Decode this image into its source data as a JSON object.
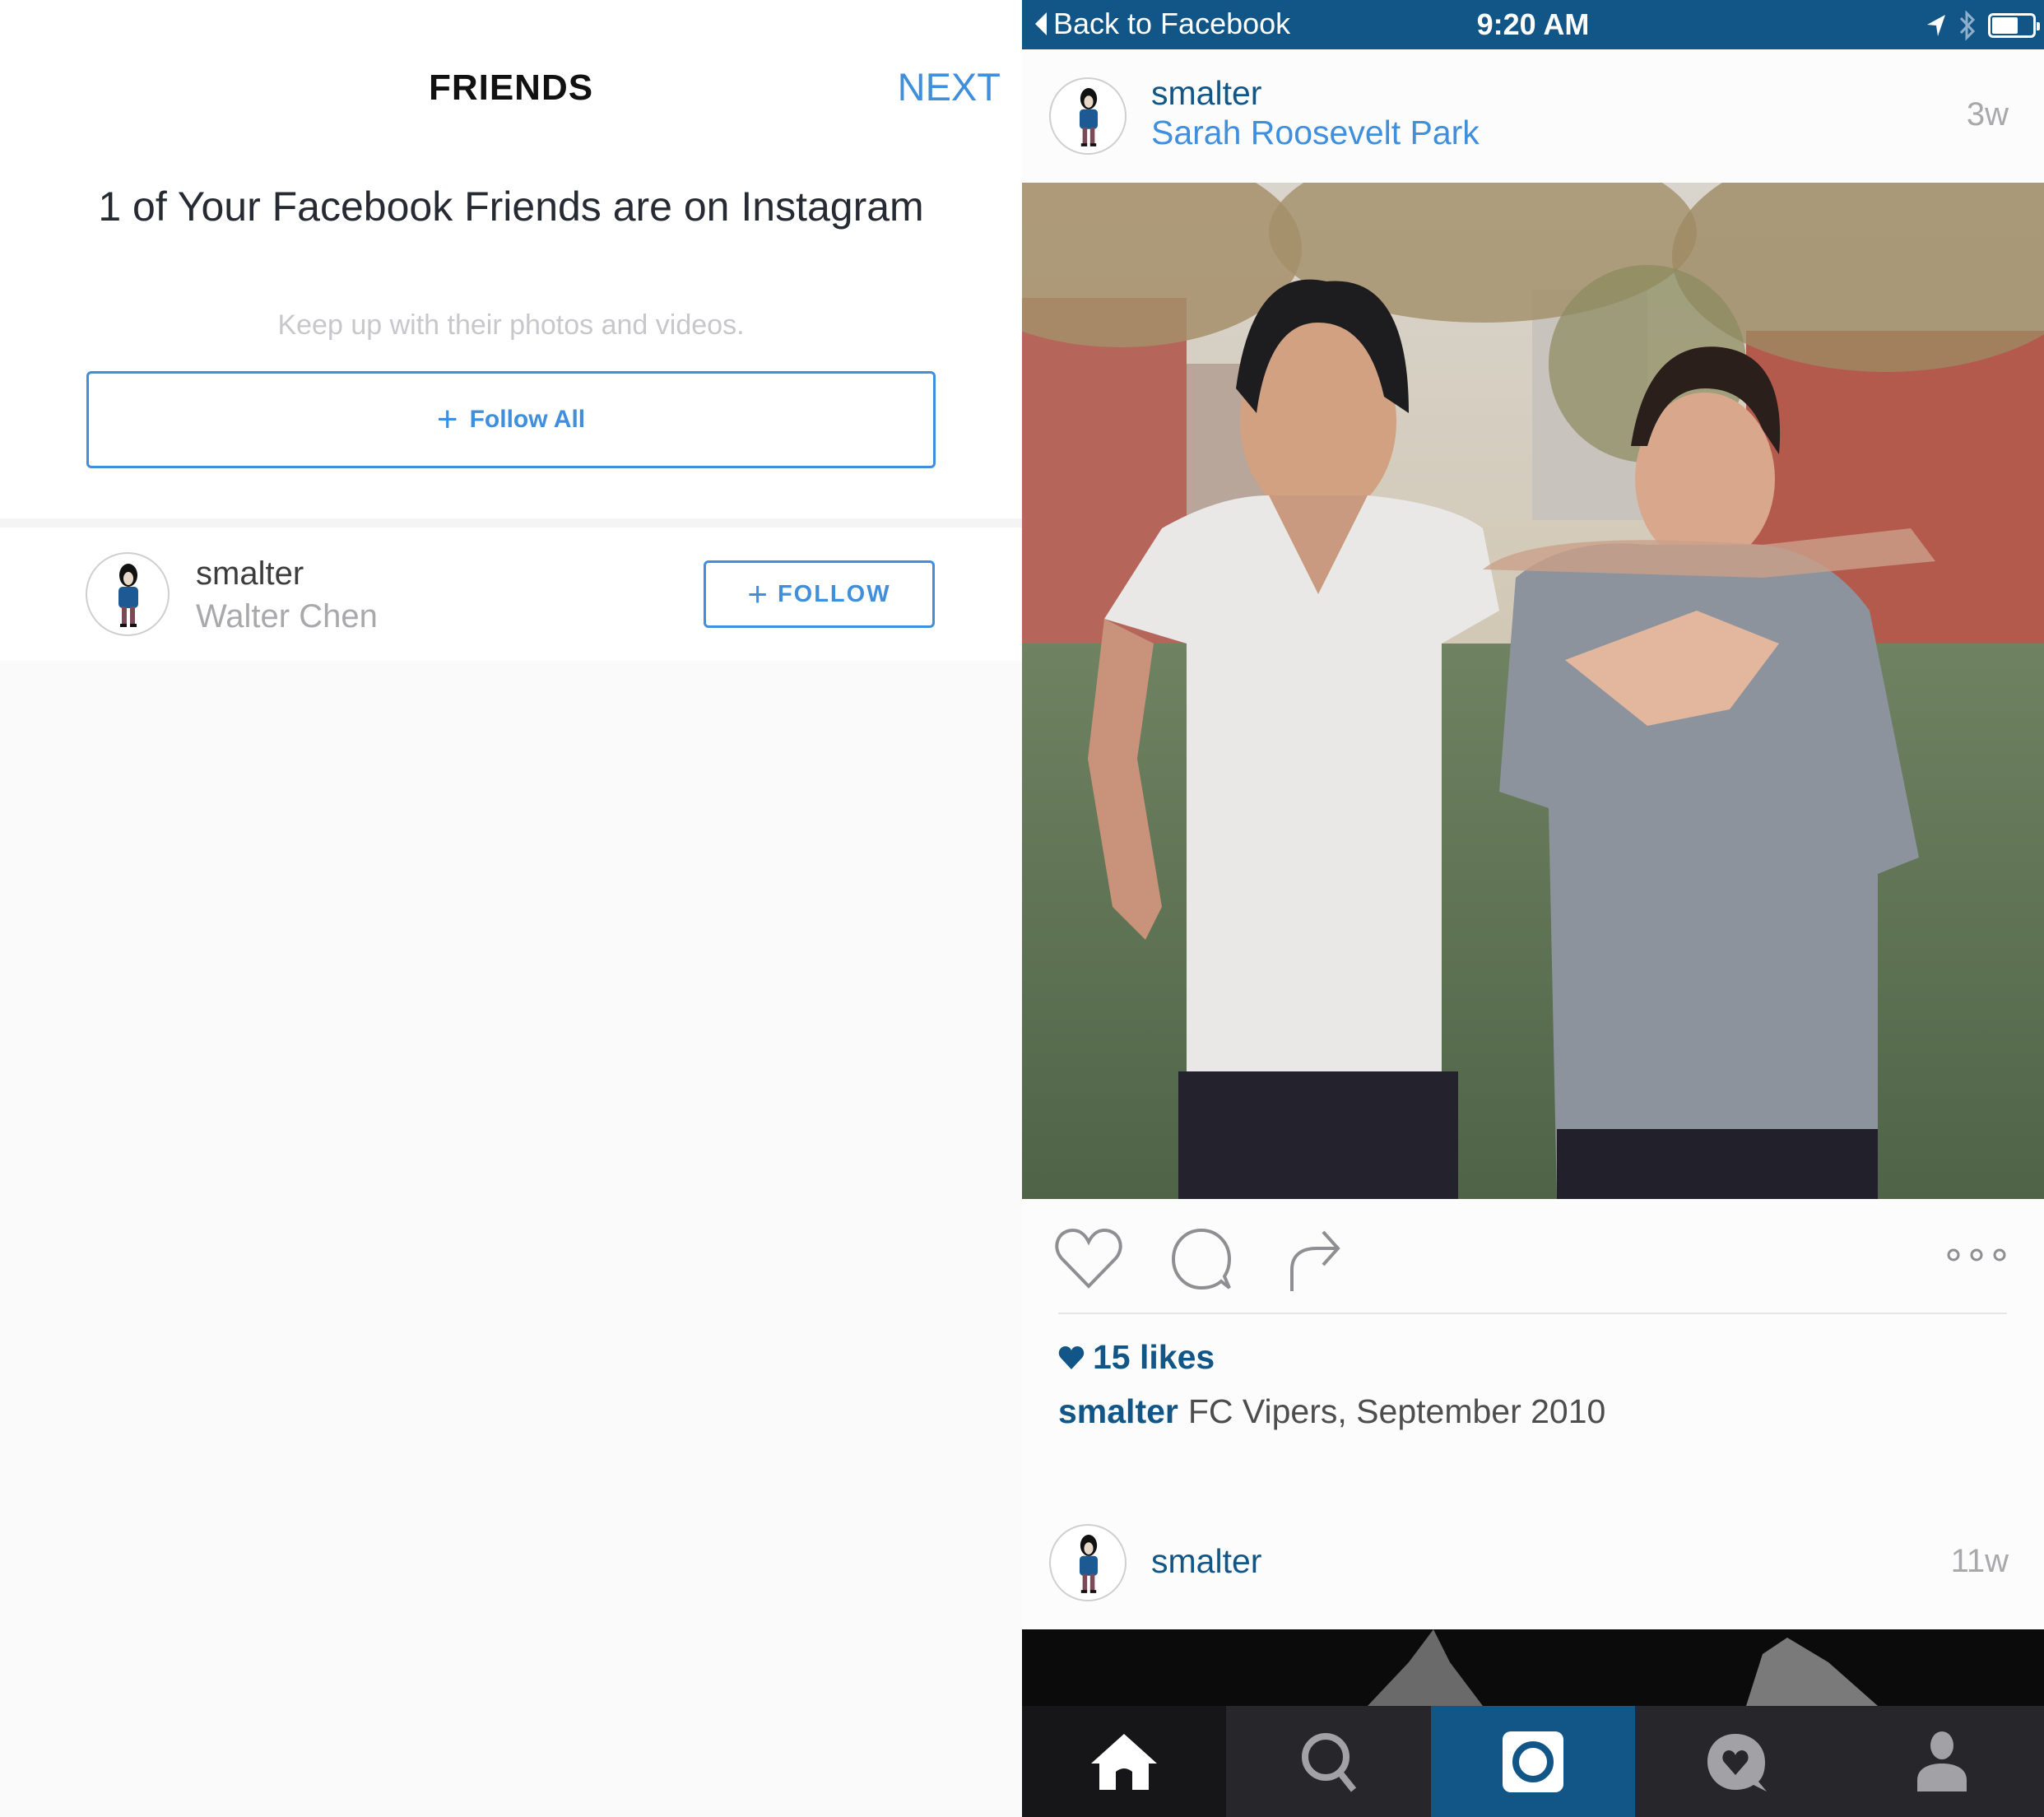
{
  "left_panel": {
    "title": "FRIENDS",
    "next_label": "NEXT",
    "heading": "1 of Your Facebook Friends are on Instagram",
    "subtitle": "Keep up with their photos and videos.",
    "follow_all_label": "Follow All",
    "friends": [
      {
        "username": "smalter",
        "full_name": "Walter Chen",
        "follow_label": "FOLLOW"
      }
    ]
  },
  "right_panel": {
    "status_bar": {
      "back_label": "Back to Facebook",
      "time": "9:20 AM",
      "icons": [
        "location-arrow-icon",
        "bluetooth-icon",
        "battery-icon"
      ]
    },
    "posts": [
      {
        "username": "smalter",
        "location": "Sarah Roosevelt Park",
        "age": "3w",
        "photo_description": "Two young men in wet t-shirts standing on a soccer field in the rain, trees and brick buildings behind",
        "likes": "15 likes",
        "caption_user": "smalter",
        "caption_text": "FC Vipers, September 2010"
      },
      {
        "username": "smalter",
        "age": "11w",
        "photo_description": "Black and white photo of building spires"
      }
    ],
    "tab_bar": [
      {
        "name": "home",
        "icon": "home-icon",
        "active": true
      },
      {
        "name": "search",
        "icon": "search-icon",
        "active": false
      },
      {
        "name": "camera",
        "icon": "camera-icon",
        "active": false
      },
      {
        "name": "activity",
        "icon": "activity-heart-icon",
        "active": false
      },
      {
        "name": "profile",
        "icon": "profile-icon",
        "active": false
      }
    ]
  },
  "colors": {
    "brand_blue": "#125688",
    "link_blue": "#3f8fdc",
    "tabbar_bg": "#26262b"
  }
}
